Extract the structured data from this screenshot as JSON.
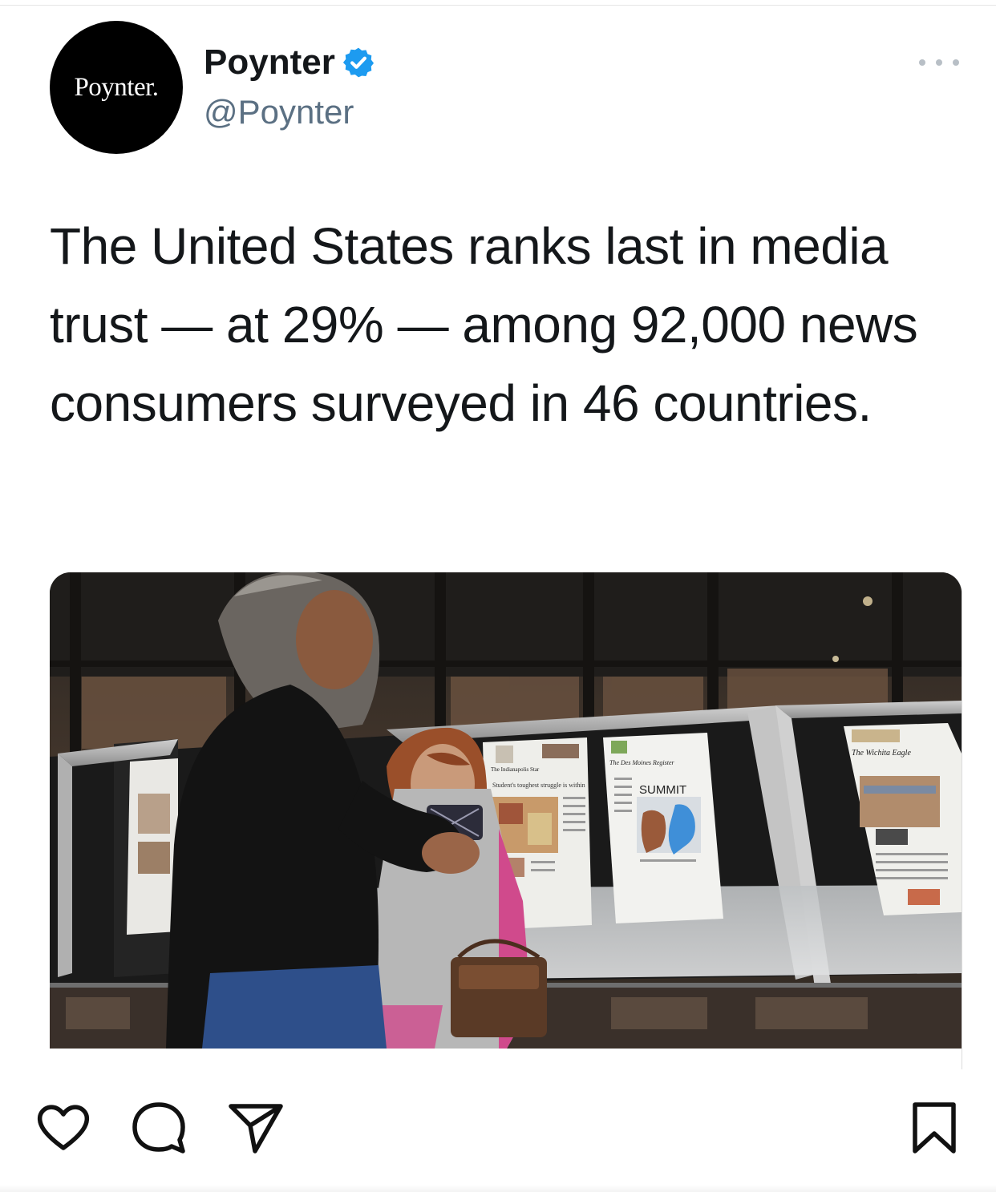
{
  "post": {
    "avatar_text": "Poynter.",
    "display_name": "Poynter",
    "handle": "@Poynter",
    "verified": true,
    "text": "The United States ranks last in media trust — at 29% — among 92,000 news consumers surveyed in 46 countries."
  },
  "media": {
    "newspapers": [
      {
        "masthead": "The Indianapolis Star",
        "headline": "Student's toughest struggle is within"
      },
      {
        "masthead": "The Des Moines Register",
        "headline": "SUMMIT"
      },
      {
        "masthead": "The Wichita Eagle",
        "headline": ""
      }
    ]
  },
  "actions": {
    "like": "heart-icon",
    "comment": "comment-bubble-icon",
    "share": "send-icon",
    "bookmark": "bookmark-icon"
  },
  "colors": {
    "verified": "#1d9bf0",
    "text": "#14171a",
    "secondary": "#5b7083",
    "avatar_bg": "#000000"
  }
}
